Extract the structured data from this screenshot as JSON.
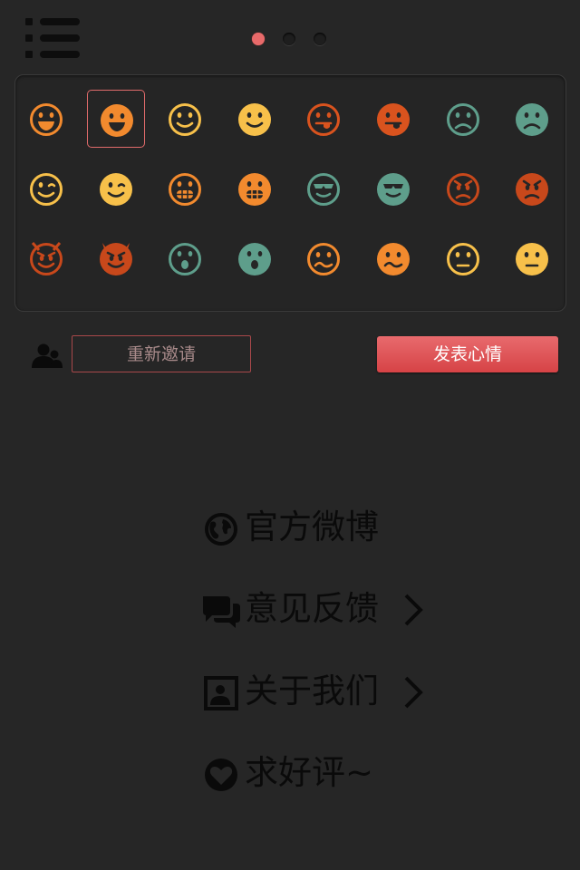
{
  "header": {
    "menu_icon": "list-menu-icon",
    "page_dots": {
      "count": 3,
      "active_index": 0,
      "active_color": "#e86a6a"
    }
  },
  "emoji_grid": {
    "selected_index": 1,
    "rows": [
      [
        {
          "name": "big-smile",
          "color": "#f28a2e",
          "style": "outline"
        },
        {
          "name": "big-smile",
          "color": "#f28a2e",
          "style": "filled"
        },
        {
          "name": "smile",
          "color": "#f7c04a",
          "style": "outline"
        },
        {
          "name": "smile",
          "color": "#f7c04a",
          "style": "filled"
        },
        {
          "name": "tongue",
          "color": "#d9531e",
          "style": "outline"
        },
        {
          "name": "tongue",
          "color": "#d9531e",
          "style": "filled"
        },
        {
          "name": "sad",
          "color": "#5e9e8b",
          "style": "outline"
        },
        {
          "name": "sad",
          "color": "#5e9e8b",
          "style": "filled"
        }
      ],
      [
        {
          "name": "wink",
          "color": "#f7c04a",
          "style": "outline"
        },
        {
          "name": "wink",
          "color": "#f7c04a",
          "style": "filled"
        },
        {
          "name": "grin",
          "color": "#f28a2e",
          "style": "outline"
        },
        {
          "name": "grin",
          "color": "#f28a2e",
          "style": "filled"
        },
        {
          "name": "cool",
          "color": "#5e9e8b",
          "style": "outline"
        },
        {
          "name": "cool",
          "color": "#5e9e8b",
          "style": "filled"
        },
        {
          "name": "angry",
          "color": "#c8481b",
          "style": "outline"
        },
        {
          "name": "angry",
          "color": "#c8481b",
          "style": "filled"
        }
      ],
      [
        {
          "name": "devil",
          "color": "#c8481b",
          "style": "outline"
        },
        {
          "name": "devil",
          "color": "#c8481b",
          "style": "filled"
        },
        {
          "name": "surprised",
          "color": "#5e9e8b",
          "style": "outline"
        },
        {
          "name": "surprised",
          "color": "#5e9e8b",
          "style": "filled"
        },
        {
          "name": "confused",
          "color": "#f28a2e",
          "style": "outline"
        },
        {
          "name": "confused",
          "color": "#f28a2e",
          "style": "filled"
        },
        {
          "name": "neutral",
          "color": "#f7c04a",
          "style": "outline"
        },
        {
          "name": "neutral",
          "color": "#f7c04a",
          "style": "filled"
        }
      ]
    ]
  },
  "actions": {
    "friends_icon": "friends-icon",
    "reinvite_label": "重新邀请",
    "post_label": "发表心情",
    "post_color": "#dd5457"
  },
  "menu": [
    {
      "label": "官方微博",
      "icon": "globe-icon",
      "has_chevron": false
    },
    {
      "label": "意见反馈",
      "icon": "chat-bubbles-icon",
      "has_chevron": true
    },
    {
      "label": "关于我们",
      "icon": "contact-card-icon",
      "has_chevron": true
    },
    {
      "label": "求好评~",
      "icon": "heart-icon",
      "has_chevron": false
    }
  ]
}
